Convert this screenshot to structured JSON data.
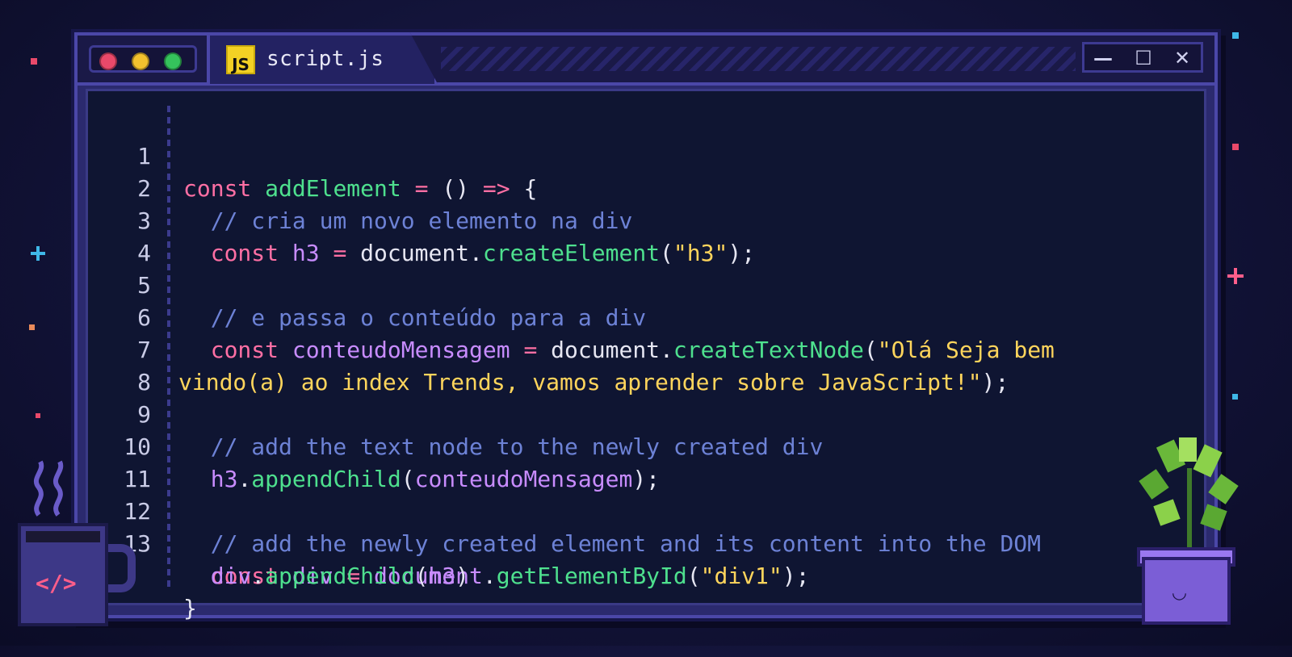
{
  "window": {
    "tab_badge": "JS",
    "tab_title": "script.js",
    "controls": {
      "minimize": "—",
      "maximize": "☐",
      "close": "✕"
    }
  },
  "editor": {
    "line_numbers": [
      "1",
      "2",
      "3",
      "4",
      "5",
      "6",
      "7",
      "8",
      "9",
      "10",
      "11",
      "12",
      "13"
    ],
    "lines": {
      "l1": {
        "a": "const",
        "b": "addElement",
        "c": "=",
        "d": "()",
        "e": "=>",
        "f": "{"
      },
      "l2": {
        "a": "// cria um novo elemento na div"
      },
      "l3": {
        "a": "const",
        "b": "h3",
        "c": "=",
        "d": "document.",
        "e": "createElement",
        "f": "(",
        "g": "\"h3\"",
        "h": ");"
      },
      "l5": {
        "a": "// e passa o conteúdo para a div"
      },
      "l6": {
        "a": "const",
        "b": "conteudoMensagem",
        "c": "=",
        "d": "document.",
        "e": "createTextNode",
        "f": "(",
        "g": "\"Olá Seja bem"
      },
      "l7": {
        "a": "vindo(a) ao index Trends, vamos aprender sobre JavaScript!\"",
        "b": ");"
      },
      "l9": {
        "a": "// add the text node to the newly created div"
      },
      "l10": {
        "a": "h3",
        "b": ".",
        "c": "appendChild",
        "d": "(",
        "e": "conteudoMensagem",
        "f": ");"
      },
      "l12": {
        "a": "// add the newly created element and its content into the DOM"
      },
      "l13": {
        "a": "const",
        "b": "div",
        "c": "=",
        "d": "document",
        "e": ".",
        "f": "getElementById",
        "g": "(",
        "h": "\"div1\"",
        "i": ");"
      },
      "l14": {
        "a": "div",
        "b": ".",
        "c": "appendChild",
        "d": "(",
        "e": "h3",
        "f": ")"
      },
      "l15": {
        "a": "}"
      }
    }
  },
  "decor": {
    "mug_text": "</>",
    "pot_face": "◡",
    "icons": [
      "mug-icon",
      "plant-icon",
      "sparkle-icon"
    ]
  },
  "colors": {
    "keyword": "#ff6fa4",
    "function": "#4ee08e",
    "variable": "#c88cff",
    "string": "#ffd55c",
    "comment": "#6d82d6",
    "background": "#0f1532"
  }
}
